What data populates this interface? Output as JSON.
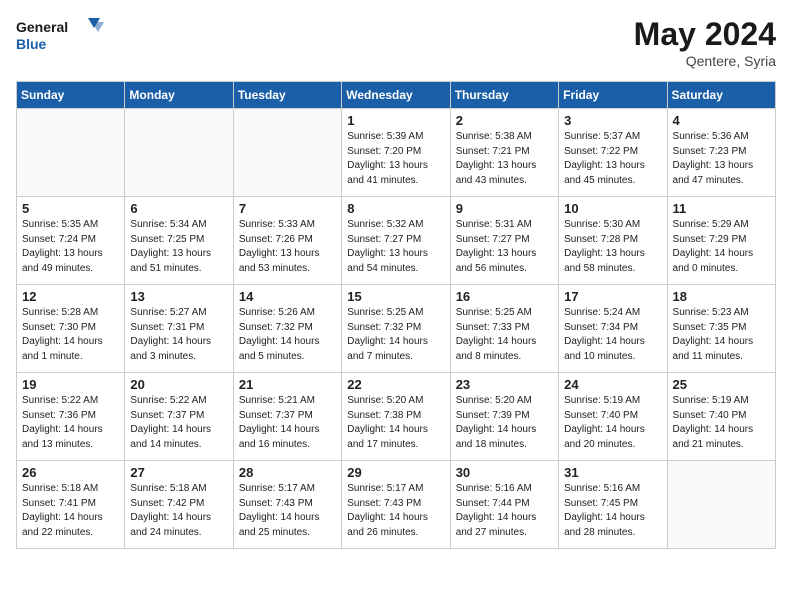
{
  "header": {
    "logo_line1": "General",
    "logo_line2": "Blue",
    "month_year": "May 2024",
    "location": "Qentere, Syria"
  },
  "days_of_week": [
    "Sunday",
    "Monday",
    "Tuesday",
    "Wednesday",
    "Thursday",
    "Friday",
    "Saturday"
  ],
  "weeks": [
    [
      {
        "day": "",
        "info": ""
      },
      {
        "day": "",
        "info": ""
      },
      {
        "day": "",
        "info": ""
      },
      {
        "day": "1",
        "info": "Sunrise: 5:39 AM\nSunset: 7:20 PM\nDaylight: 13 hours\nand 41 minutes."
      },
      {
        "day": "2",
        "info": "Sunrise: 5:38 AM\nSunset: 7:21 PM\nDaylight: 13 hours\nand 43 minutes."
      },
      {
        "day": "3",
        "info": "Sunrise: 5:37 AM\nSunset: 7:22 PM\nDaylight: 13 hours\nand 45 minutes."
      },
      {
        "day": "4",
        "info": "Sunrise: 5:36 AM\nSunset: 7:23 PM\nDaylight: 13 hours\nand 47 minutes."
      }
    ],
    [
      {
        "day": "5",
        "info": "Sunrise: 5:35 AM\nSunset: 7:24 PM\nDaylight: 13 hours\nand 49 minutes."
      },
      {
        "day": "6",
        "info": "Sunrise: 5:34 AM\nSunset: 7:25 PM\nDaylight: 13 hours\nand 51 minutes."
      },
      {
        "day": "7",
        "info": "Sunrise: 5:33 AM\nSunset: 7:26 PM\nDaylight: 13 hours\nand 53 minutes."
      },
      {
        "day": "8",
        "info": "Sunrise: 5:32 AM\nSunset: 7:27 PM\nDaylight: 13 hours\nand 54 minutes."
      },
      {
        "day": "9",
        "info": "Sunrise: 5:31 AM\nSunset: 7:27 PM\nDaylight: 13 hours\nand 56 minutes."
      },
      {
        "day": "10",
        "info": "Sunrise: 5:30 AM\nSunset: 7:28 PM\nDaylight: 13 hours\nand 58 minutes."
      },
      {
        "day": "11",
        "info": "Sunrise: 5:29 AM\nSunset: 7:29 PM\nDaylight: 14 hours\nand 0 minutes."
      }
    ],
    [
      {
        "day": "12",
        "info": "Sunrise: 5:28 AM\nSunset: 7:30 PM\nDaylight: 14 hours\nand 1 minute."
      },
      {
        "day": "13",
        "info": "Sunrise: 5:27 AM\nSunset: 7:31 PM\nDaylight: 14 hours\nand 3 minutes."
      },
      {
        "day": "14",
        "info": "Sunrise: 5:26 AM\nSunset: 7:32 PM\nDaylight: 14 hours\nand 5 minutes."
      },
      {
        "day": "15",
        "info": "Sunrise: 5:25 AM\nSunset: 7:32 PM\nDaylight: 14 hours\nand 7 minutes."
      },
      {
        "day": "16",
        "info": "Sunrise: 5:25 AM\nSunset: 7:33 PM\nDaylight: 14 hours\nand 8 minutes."
      },
      {
        "day": "17",
        "info": "Sunrise: 5:24 AM\nSunset: 7:34 PM\nDaylight: 14 hours\nand 10 minutes."
      },
      {
        "day": "18",
        "info": "Sunrise: 5:23 AM\nSunset: 7:35 PM\nDaylight: 14 hours\nand 11 minutes."
      }
    ],
    [
      {
        "day": "19",
        "info": "Sunrise: 5:22 AM\nSunset: 7:36 PM\nDaylight: 14 hours\nand 13 minutes."
      },
      {
        "day": "20",
        "info": "Sunrise: 5:22 AM\nSunset: 7:37 PM\nDaylight: 14 hours\nand 14 minutes."
      },
      {
        "day": "21",
        "info": "Sunrise: 5:21 AM\nSunset: 7:37 PM\nDaylight: 14 hours\nand 16 minutes."
      },
      {
        "day": "22",
        "info": "Sunrise: 5:20 AM\nSunset: 7:38 PM\nDaylight: 14 hours\nand 17 minutes."
      },
      {
        "day": "23",
        "info": "Sunrise: 5:20 AM\nSunset: 7:39 PM\nDaylight: 14 hours\nand 18 minutes."
      },
      {
        "day": "24",
        "info": "Sunrise: 5:19 AM\nSunset: 7:40 PM\nDaylight: 14 hours\nand 20 minutes."
      },
      {
        "day": "25",
        "info": "Sunrise: 5:19 AM\nSunset: 7:40 PM\nDaylight: 14 hours\nand 21 minutes."
      }
    ],
    [
      {
        "day": "26",
        "info": "Sunrise: 5:18 AM\nSunset: 7:41 PM\nDaylight: 14 hours\nand 22 minutes."
      },
      {
        "day": "27",
        "info": "Sunrise: 5:18 AM\nSunset: 7:42 PM\nDaylight: 14 hours\nand 24 minutes."
      },
      {
        "day": "28",
        "info": "Sunrise: 5:17 AM\nSunset: 7:43 PM\nDaylight: 14 hours\nand 25 minutes."
      },
      {
        "day": "29",
        "info": "Sunrise: 5:17 AM\nSunset: 7:43 PM\nDaylight: 14 hours\nand 26 minutes."
      },
      {
        "day": "30",
        "info": "Sunrise: 5:16 AM\nSunset: 7:44 PM\nDaylight: 14 hours\nand 27 minutes."
      },
      {
        "day": "31",
        "info": "Sunrise: 5:16 AM\nSunset: 7:45 PM\nDaylight: 14 hours\nand 28 minutes."
      },
      {
        "day": "",
        "info": ""
      }
    ]
  ]
}
